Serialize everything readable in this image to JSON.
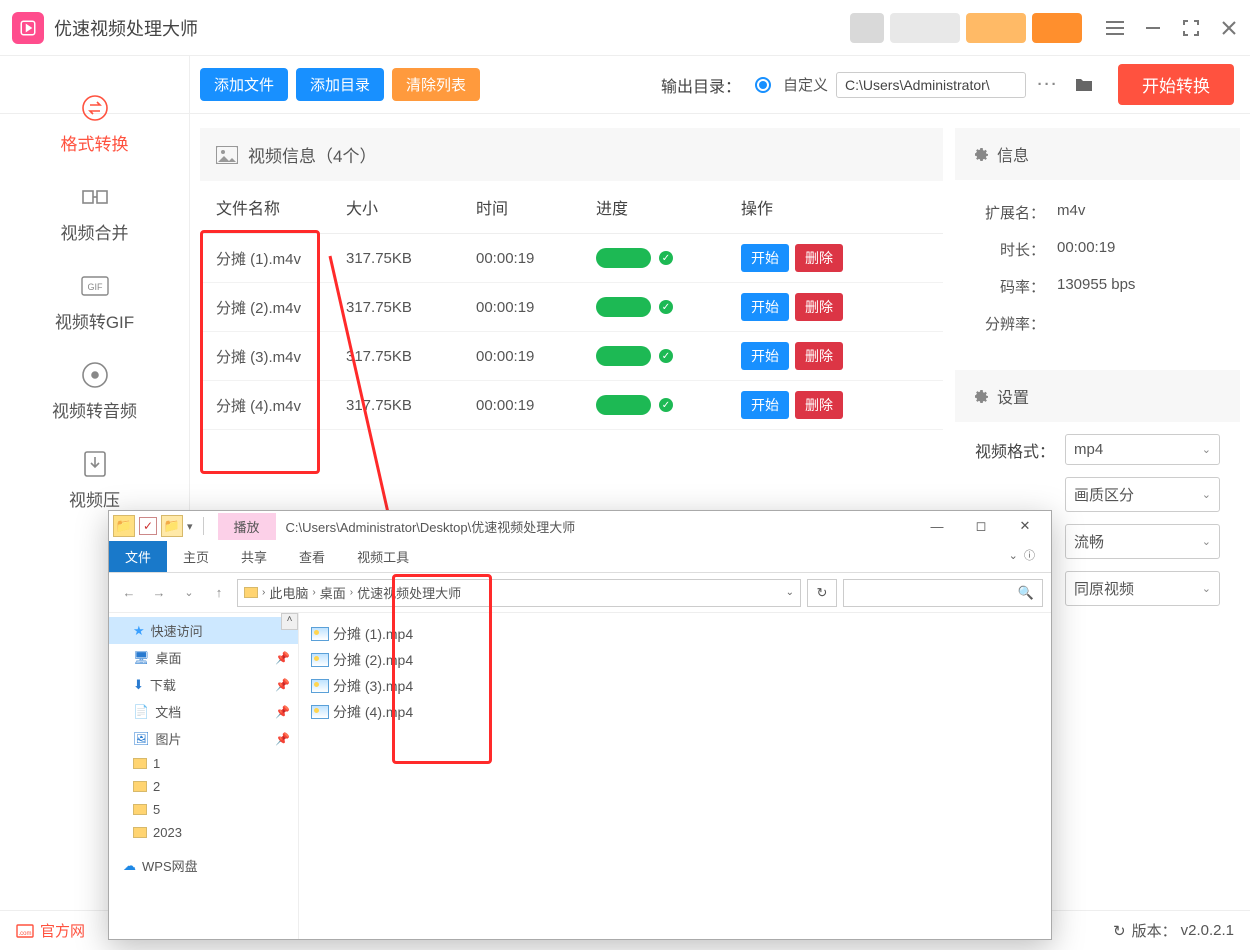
{
  "app": {
    "title": "优速视频处理大师"
  },
  "toolbar": {
    "add_file": "添加文件",
    "add_dir": "添加目录",
    "clear": "清除列表",
    "output_label": "输出目录：",
    "custom": "自定义",
    "path": "C:\\Users\\Administrator\\",
    "start": "开始转换"
  },
  "sidebar": {
    "items": [
      {
        "label": "格式转换"
      },
      {
        "label": "视频合并"
      },
      {
        "label": "视频转GIF"
      },
      {
        "label": "视频转音频"
      },
      {
        "label": "视频压"
      }
    ]
  },
  "list": {
    "header": "视频信息（4个）",
    "cols": {
      "name": "文件名称",
      "size": "大小",
      "time": "时间",
      "progress": "进度",
      "action": "操作"
    },
    "action_start": "开始",
    "action_delete": "删除",
    "rows": [
      {
        "name": "分摊 (1).m4v",
        "size": "317.75KB",
        "time": "00:00:19"
      },
      {
        "name": "分摊 (2).m4v",
        "size": "317.75KB",
        "time": "00:00:19"
      },
      {
        "name": "分摊 (3).m4v",
        "size": "317.75KB",
        "time": "00:00:19"
      },
      {
        "name": "分摊 (4).m4v",
        "size": "317.75KB",
        "time": "00:00:19"
      }
    ]
  },
  "info": {
    "title": "信息",
    "ext_label": "扩展名：",
    "ext": "m4v",
    "dur_label": "时长：",
    "dur": "00:00:19",
    "rate_label": "码率：",
    "rate": "130955 bps",
    "res_label": "分辨率："
  },
  "settings": {
    "title": "设置",
    "fmt_label": "视频格式：",
    "fmt_val": "mp4",
    "qual_label_suffix": "画质区分",
    "smooth_suffix": "流畅",
    "same_suffix": "同原视频"
  },
  "footer": {
    "official": "官方网",
    "version_label": "版本：",
    "version": "v2.0.2.1"
  },
  "explorer": {
    "play_tab": "播放",
    "path_title": "C:\\Users\\Administrator\\Desktop\\优速视频处理大师",
    "ribbon": {
      "file": "文件",
      "home": "主页",
      "share": "共享",
      "view": "查看",
      "video_tools": "视频工具"
    },
    "breadcrumb": [
      "此电脑",
      "桌面",
      "优速视频处理大师"
    ],
    "tree": {
      "quick": "快速访问",
      "desktop": "桌面",
      "downloads": "下载",
      "documents": "文档",
      "pictures": "图片",
      "f1": "1",
      "f2": "2",
      "f5": "5",
      "f2023": "2023",
      "wps": "WPS网盘"
    },
    "files": [
      "分摊 (1).mp4",
      "分摊 (2).mp4",
      "分摊 (3).mp4",
      "分摊 (4).mp4"
    ]
  }
}
